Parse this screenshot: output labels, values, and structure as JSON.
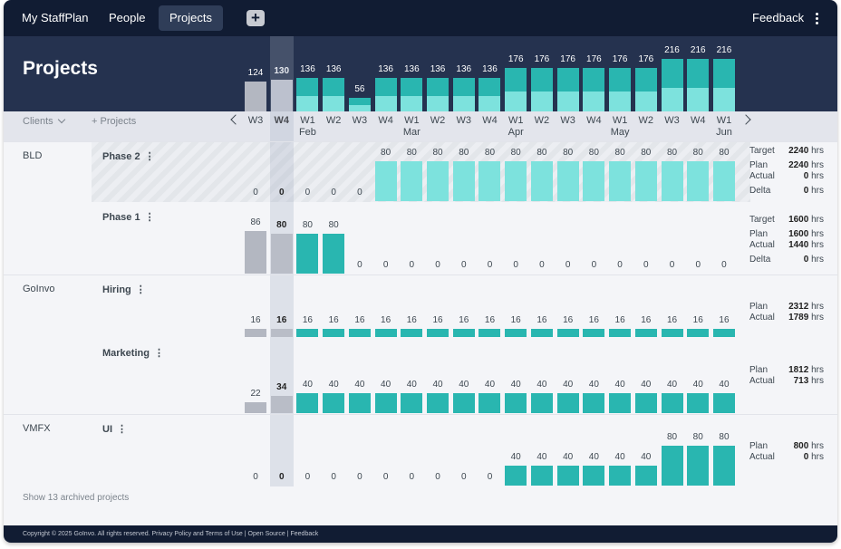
{
  "nav": {
    "brand": "My StaffPlan",
    "people": "People",
    "projects": "Projects",
    "add_symbol": "+",
    "feedback": "Feedback"
  },
  "page": {
    "title": "Projects"
  },
  "colors": {
    "teal": "#29b6b0",
    "teal_light": "#7de2dd",
    "gray_bar": "#b3b7c1",
    "nav_bg": "#111c33",
    "header_bg": "#25324f"
  },
  "header_totals": [
    "124",
    "130",
    "136",
    "136",
    "56",
    "136",
    "136",
    "136",
    "136",
    "136",
    "176",
    "176",
    "176",
    "176",
    "176",
    "176",
    "216",
    "216",
    "216"
  ],
  "week_bar": {
    "clients_label": "Clients",
    "projects_label": "+ Projects",
    "prev_icon": "chevron-left",
    "next_icon": "chevron-right",
    "weeks": [
      {
        "w": "W3",
        "m": ""
      },
      {
        "w": "W4",
        "m": ""
      },
      {
        "w": "W1",
        "m": "Feb"
      },
      {
        "w": "W2",
        "m": ""
      },
      {
        "w": "W3",
        "m": ""
      },
      {
        "w": "W4",
        "m": ""
      },
      {
        "w": "W1",
        "m": "Mar"
      },
      {
        "w": "W2",
        "m": ""
      },
      {
        "w": "W3",
        "m": ""
      },
      {
        "w": "W4",
        "m": ""
      },
      {
        "w": "W1",
        "m": "Apr"
      },
      {
        "w": "W2",
        "m": ""
      },
      {
        "w": "W3",
        "m": ""
      },
      {
        "w": "W4",
        "m": ""
      },
      {
        "w": "W1",
        "m": "May"
      },
      {
        "w": "W2",
        "m": ""
      },
      {
        "w": "W3",
        "m": ""
      },
      {
        "w": "W4",
        "m": ""
      },
      {
        "w": "W1",
        "m": "Jun"
      }
    ]
  },
  "rows": [
    {
      "client": "BLD",
      "project": "Phase 2",
      "kebab": "⋮",
      "values": [
        "0",
        "0",
        "0",
        "0",
        "0",
        "80",
        "80",
        "80",
        "80",
        "80",
        "80",
        "80",
        "80",
        "80",
        "80",
        "80",
        "80",
        "80",
        "80"
      ],
      "stats": [
        {
          "k": "Target",
          "v": "2240",
          "u": "hrs"
        },
        {
          "k": "Plan",
          "v": "2240",
          "u": "hrs"
        },
        {
          "k": "Actual",
          "v": "0",
          "u": "hrs"
        },
        {
          "k": "Delta",
          "v": "0",
          "u": "hrs"
        }
      ]
    },
    {
      "client": "",
      "project": "Phase 1",
      "kebab": "⋮",
      "values": [
        "86",
        "80",
        "80",
        "80",
        "0",
        "0",
        "0",
        "0",
        "0",
        "0",
        "0",
        "0",
        "0",
        "0",
        "0",
        "0",
        "0",
        "0",
        "0"
      ],
      "stats": [
        {
          "k": "Target",
          "v": "1600",
          "u": "hrs"
        },
        {
          "k": "Plan",
          "v": "1600",
          "u": "hrs"
        },
        {
          "k": "Actual",
          "v": "1440",
          "u": "hrs"
        },
        {
          "k": "Delta",
          "v": "0",
          "u": "hrs"
        }
      ]
    },
    {
      "client": "GoInvo",
      "project": "Hiring",
      "kebab": "⋮",
      "values": [
        "16",
        "16",
        "16",
        "16",
        "16",
        "16",
        "16",
        "16",
        "16",
        "16",
        "16",
        "16",
        "16",
        "16",
        "16",
        "16",
        "16",
        "16",
        "16"
      ],
      "stats": [
        {
          "k": "Plan",
          "v": "2312",
          "u": "hrs"
        },
        {
          "k": "Actual",
          "v": "1789",
          "u": "hrs"
        }
      ]
    },
    {
      "client": "",
      "project": "Marketing",
      "kebab": "⋮",
      "values": [
        "22",
        "34",
        "40",
        "40",
        "40",
        "40",
        "40",
        "40",
        "40",
        "40",
        "40",
        "40",
        "40",
        "40",
        "40",
        "40",
        "40",
        "40",
        "40"
      ],
      "stats": [
        {
          "k": "Plan",
          "v": "1812",
          "u": "hrs"
        },
        {
          "k": "Actual",
          "v": "713",
          "u": "hrs"
        }
      ]
    },
    {
      "client": "VMFX",
      "project": "UI",
      "kebab": "⋮",
      "values": [
        "0",
        "0",
        "0",
        "0",
        "0",
        "0",
        "0",
        "0",
        "0",
        "0",
        "40",
        "40",
        "40",
        "40",
        "40",
        "40",
        "80",
        "80",
        "80"
      ],
      "stats": [
        {
          "k": "Plan",
          "v": "800",
          "u": "hrs"
        },
        {
          "k": "Actual",
          "v": "0",
          "u": "hrs"
        }
      ]
    }
  ],
  "archived": "Show 13 archived projects",
  "footer": {
    "copyright": "Copyright © 2025 GoInvo. All rights reserved.",
    "privacy": "Privacy Policy and Terms of Use",
    "sep1": "|",
    "open_source": "Open Source",
    "sep2": "|",
    "feedback": "Feedback"
  }
}
